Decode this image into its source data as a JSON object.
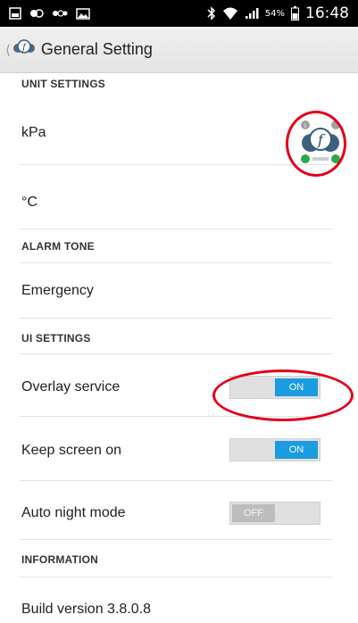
{
  "status_bar": {
    "bluetooth_icon": "bluetooth-icon",
    "wifi_icon": "wifi-icon",
    "signal_icon": "signal-icon",
    "battery_percent": "54%",
    "time": "16:48"
  },
  "app_bar": {
    "title": "General Setting"
  },
  "sections": {
    "unit_settings": "UNIT SETTINGS",
    "alarm_tone": "ALARM TONE",
    "ui_settings": "UI SETTINGS",
    "information": "INFORMATION"
  },
  "rows": {
    "pressure_unit": "kPa",
    "temperature_unit": "°C",
    "alarm_tone_value": "Emergency",
    "overlay_service": "Overlay service",
    "keep_screen_on": "Keep screen on",
    "auto_night_mode": "Auto night mode",
    "build_version": "Build version  3.8.0.8"
  },
  "toggles": {
    "overlay_service": {
      "label": "ON",
      "state": "on"
    },
    "keep_screen_on": {
      "label": "ON",
      "state": "on"
    },
    "auto_night_mode": {
      "label": "OFF",
      "state": "off"
    }
  },
  "colors": {
    "toggle_on": "#1b9be0",
    "toggle_off": "#bdbdbd",
    "annotation": "#e0001a"
  }
}
